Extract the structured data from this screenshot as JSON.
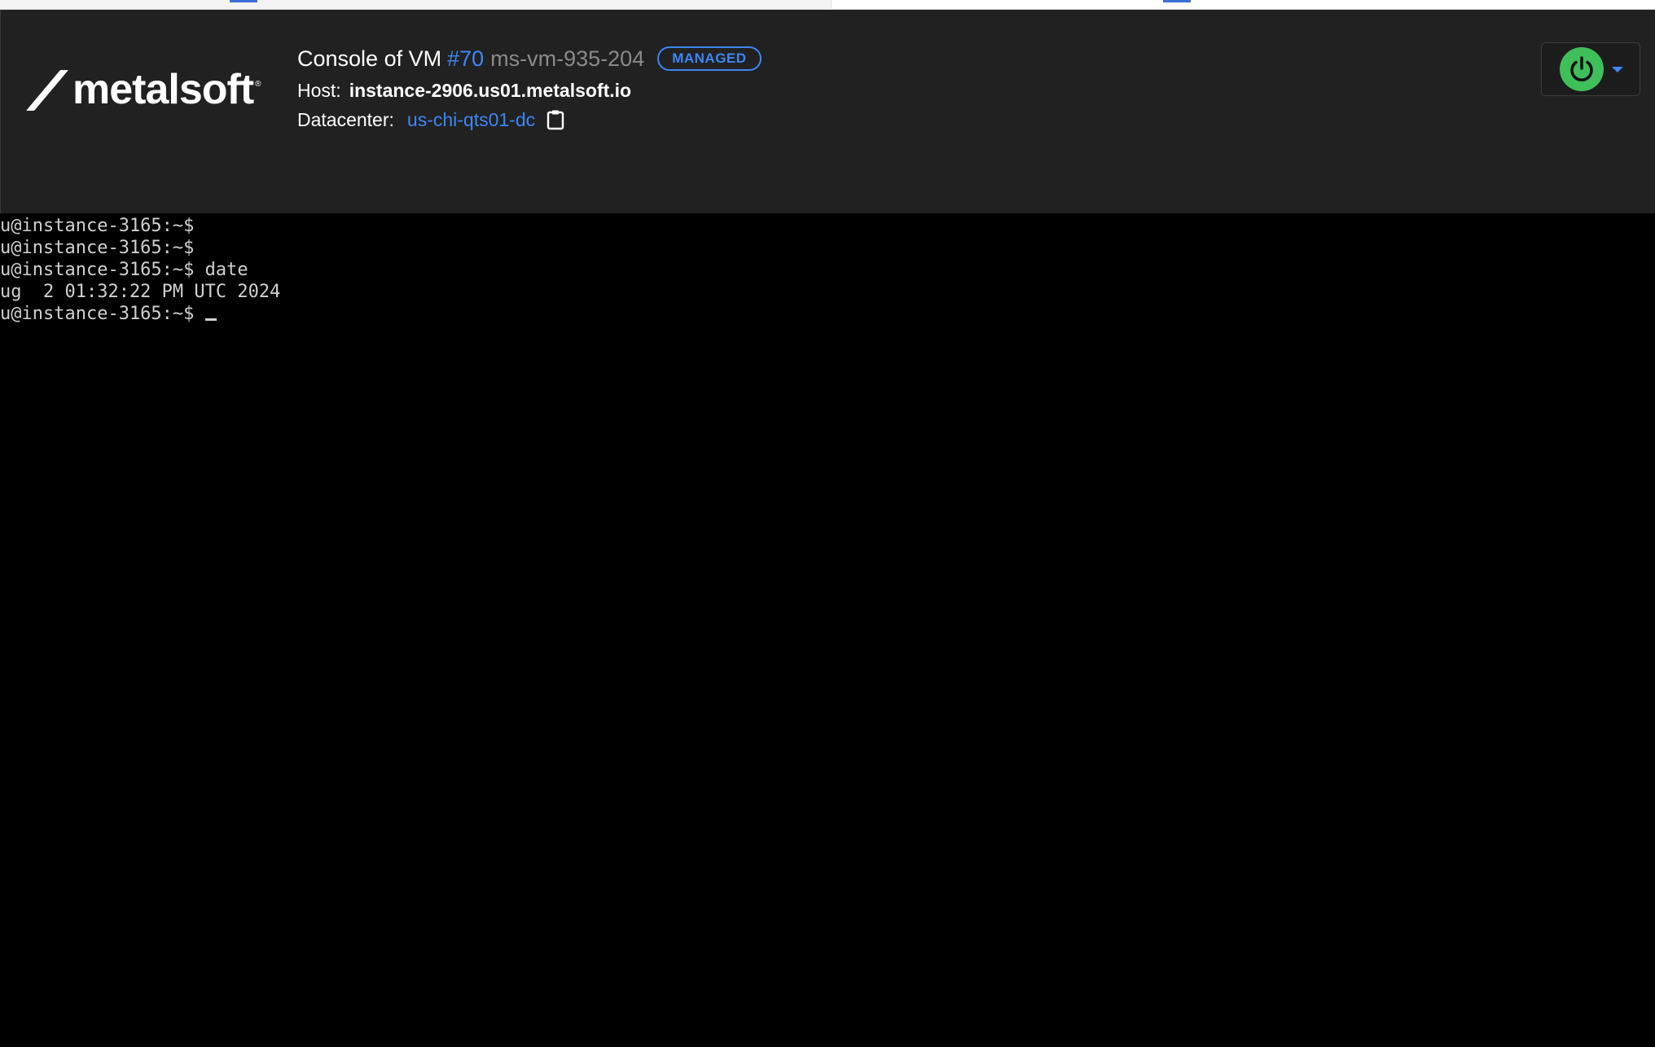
{
  "header": {
    "logo_text": "metalsoft",
    "logo_mark": "®",
    "title_prefix": "Console of VM",
    "vm_id": "#70",
    "vm_name": "ms-vm-935-204",
    "badge": "MANAGED",
    "host_label": "Host:",
    "host_value": "instance-2906.us01.metalsoft.io",
    "datacenter_label": "Datacenter:",
    "datacenter_value": "us-chi-qts01-dc"
  },
  "colors": {
    "accent": "#3d86f5",
    "power": "#3fbf5a",
    "header_bg": "#212121",
    "terminal_bg": "#000000"
  },
  "icons": {
    "copy": "clipboard-icon",
    "power": "power-icon",
    "menu": "caret-down-icon"
  },
  "terminal": {
    "lines": [
      "u@instance-3165:~$",
      "u@instance-3165:~$",
      "u@instance-3165:~$ date",
      "ug  2 01:32:22 PM UTC 2024",
      "u@instance-3165:~$ "
    ]
  }
}
